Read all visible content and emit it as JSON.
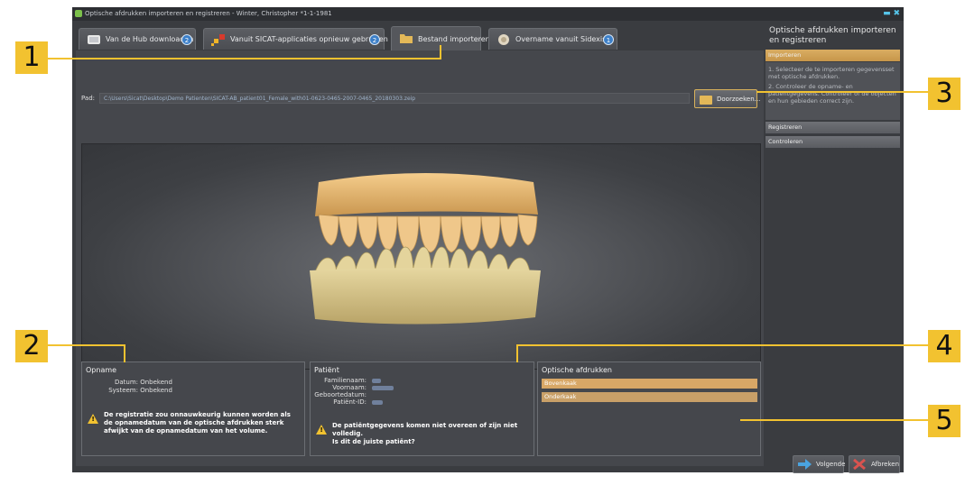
{
  "window": {
    "title": "Optische afdrukken importeren en registreren - Winter, Christopher *1-1-1981",
    "controls": [
      "minimize-icon",
      "close-icon"
    ]
  },
  "tabs": [
    {
      "label": "Van de Hub downloaden",
      "badge": "2",
      "icon": "hub-download-icon",
      "active": false
    },
    {
      "label": "Vanuit SICAT-applicaties opnieuw gebruiken",
      "badge": "2",
      "icon": "sicat-apps-icon",
      "active": false
    },
    {
      "label": "Bestand importeren",
      "badge": "",
      "icon": "folder-icon",
      "active": true
    },
    {
      "label": "Overname vanuit Sidexis 4",
      "badge": "1",
      "icon": "sidexis-icon",
      "active": false
    }
  ],
  "path": {
    "label": "Pad:",
    "value": "C:\\Users\\Sicat\\Desktop\\Demo Patienten\\SICAT-AB_patient01_Female_with01-0623-0465-2007-0465_20180303.zeip",
    "browse_label": "Doorzoeken..."
  },
  "opname": {
    "title": "Opname",
    "datum_label": "Datum:",
    "datum_value": "Onbekend",
    "systeem_label": "Systeem:",
    "systeem_value": "Onbekend",
    "warning": "De registratie zou onnauwkeurig kunnen worden als de opnamedatum van de optische afdrukken sterk afwijkt van de opnamedatum van het volume."
  },
  "patient": {
    "title": "Patiënt",
    "familienaam_label": "Familienaam:",
    "voornaam_label": "Voornaam:",
    "geboortedatum_label": "Geboortedatum:",
    "patient_id_label": "Patiënt-ID:",
    "warning_line1": "De patiëntgegevens komen niet overeen of zijn niet",
    "warning_line2": "volledig.",
    "warning_line3": "Is dit de juiste patiënt?"
  },
  "optische_afdrukken": {
    "title": "Optische afdrukken",
    "items": [
      "Bovenkaak",
      "Onderkaak"
    ]
  },
  "sidebar": {
    "title": "Optische afdrukken importeren en registreren",
    "sections": [
      {
        "label": "Importeren",
        "active": true
      },
      {
        "label": "Registreren",
        "active": false
      },
      {
        "label": "Controleren",
        "active": false
      }
    ],
    "import_steps": "1. Selecteer de te importeren gegevensset met optische afdrukken.",
    "import_step2": "2. Controleer de opname- en patiëntgegevens. Controleer of de objecten en hun gebieden correct zijn."
  },
  "buttons": {
    "next_label": "Volgende",
    "cancel_label": "Afbreken"
  },
  "callouts": [
    "1",
    "2",
    "3",
    "4",
    "5"
  ],
  "colors": {
    "accent": "#f2c230",
    "selection": "#d8a766",
    "badge": "#3c7fc8"
  }
}
